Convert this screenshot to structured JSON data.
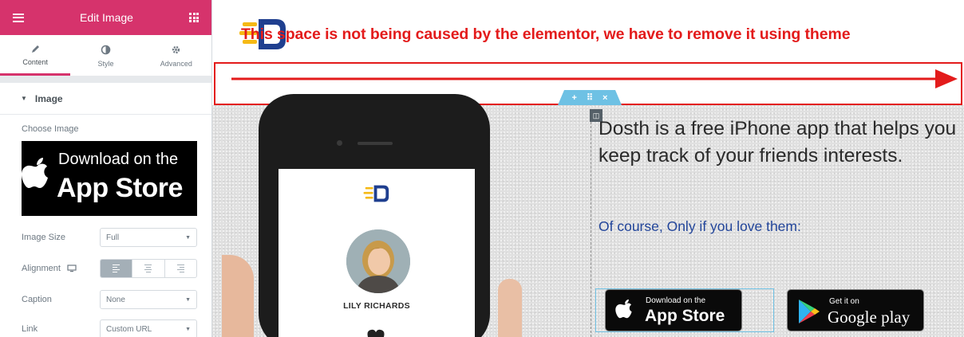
{
  "editor": {
    "title": "Edit Image",
    "tabs": [
      {
        "label": "Content"
      },
      {
        "label": "Style"
      },
      {
        "label": "Advanced"
      }
    ],
    "section_title": "Image",
    "choose_image_label": "Choose Image",
    "preview": {
      "line1": "Download on the",
      "line2": "App Store"
    },
    "controls": {
      "image_size": {
        "label": "Image Size",
        "value": "Full"
      },
      "alignment": {
        "label": "Alignment"
      },
      "caption": {
        "label": "Caption",
        "value": "None"
      },
      "link": {
        "label": "Link",
        "value": "Custom URL"
      }
    }
  },
  "canvas": {
    "annotation": "This space is not being caused by the elementor, we have to remove it using theme",
    "phone_user": "LILY RICHARDS",
    "headline": "Dosth is a free iPhone app that helps you keep track of your friends interests.",
    "subheadline": "Of course, Only if you love them:",
    "appstore": {
      "line1": "Download on the",
      "line2": "App Store"
    },
    "googleplay": {
      "line1": "Get it on",
      "line2": "Google play"
    }
  },
  "colors": {
    "accent": "#d6336c",
    "annotation": "#e31b1b",
    "handle": "#6ec1e4",
    "subheadline": "#22459a"
  }
}
